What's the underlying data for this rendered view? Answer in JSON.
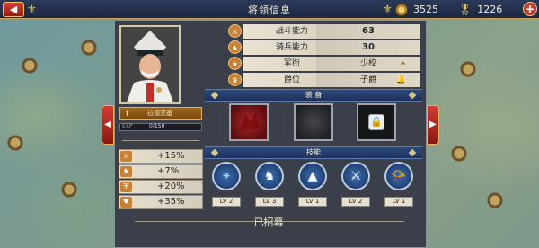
{
  "header": {
    "title": "将领信息",
    "back_icon": "back-arrow-icon",
    "gold_value": "3525",
    "medal_value": "1226",
    "plus_label": "+"
  },
  "general": {
    "name": "拉德茨基",
    "exp_label": "EXP",
    "exp_value": "0/150",
    "exp_fraction": 0.0
  },
  "bonuses": [
    {
      "icon": "sword-icon",
      "value": "+15%"
    },
    {
      "icon": "horse-icon",
      "value": "+7%"
    },
    {
      "icon": "shield-icon",
      "value": "+20%"
    },
    {
      "icon": "heart-icon",
      "value": "+35%"
    }
  ],
  "stats": [
    {
      "icon": "battle-icon",
      "label": "战斗能力",
      "value": "63"
    },
    {
      "icon": "cavalry-icon",
      "label": "骑兵能力",
      "value": "30"
    },
    {
      "icon": "rank-icon",
      "label": "军衔",
      "value": "少校"
    },
    {
      "icon": "crown-icon",
      "label": "爵位",
      "value": "子爵"
    }
  ],
  "equipment": {
    "title": "装 备",
    "slots": [
      "red-equipment",
      "empty",
      "locked"
    ]
  },
  "skills": {
    "title": "技能",
    "items": [
      {
        "icon": "crosshair-icon",
        "level": "LV 2"
      },
      {
        "icon": "cavalry-rider-icon",
        "level": "LV 3"
      },
      {
        "icon": "fortification-icon",
        "level": "LV 1"
      },
      {
        "icon": "crossed-swords-icon",
        "level": "LV 2"
      },
      {
        "icon": "trumpet-icon",
        "level": "LV 1"
      }
    ]
  },
  "status": "已招募",
  "colors": {
    "accent_red": "#c0302a",
    "header_blue": "#1e3260",
    "gold": "#c8a35a"
  }
}
